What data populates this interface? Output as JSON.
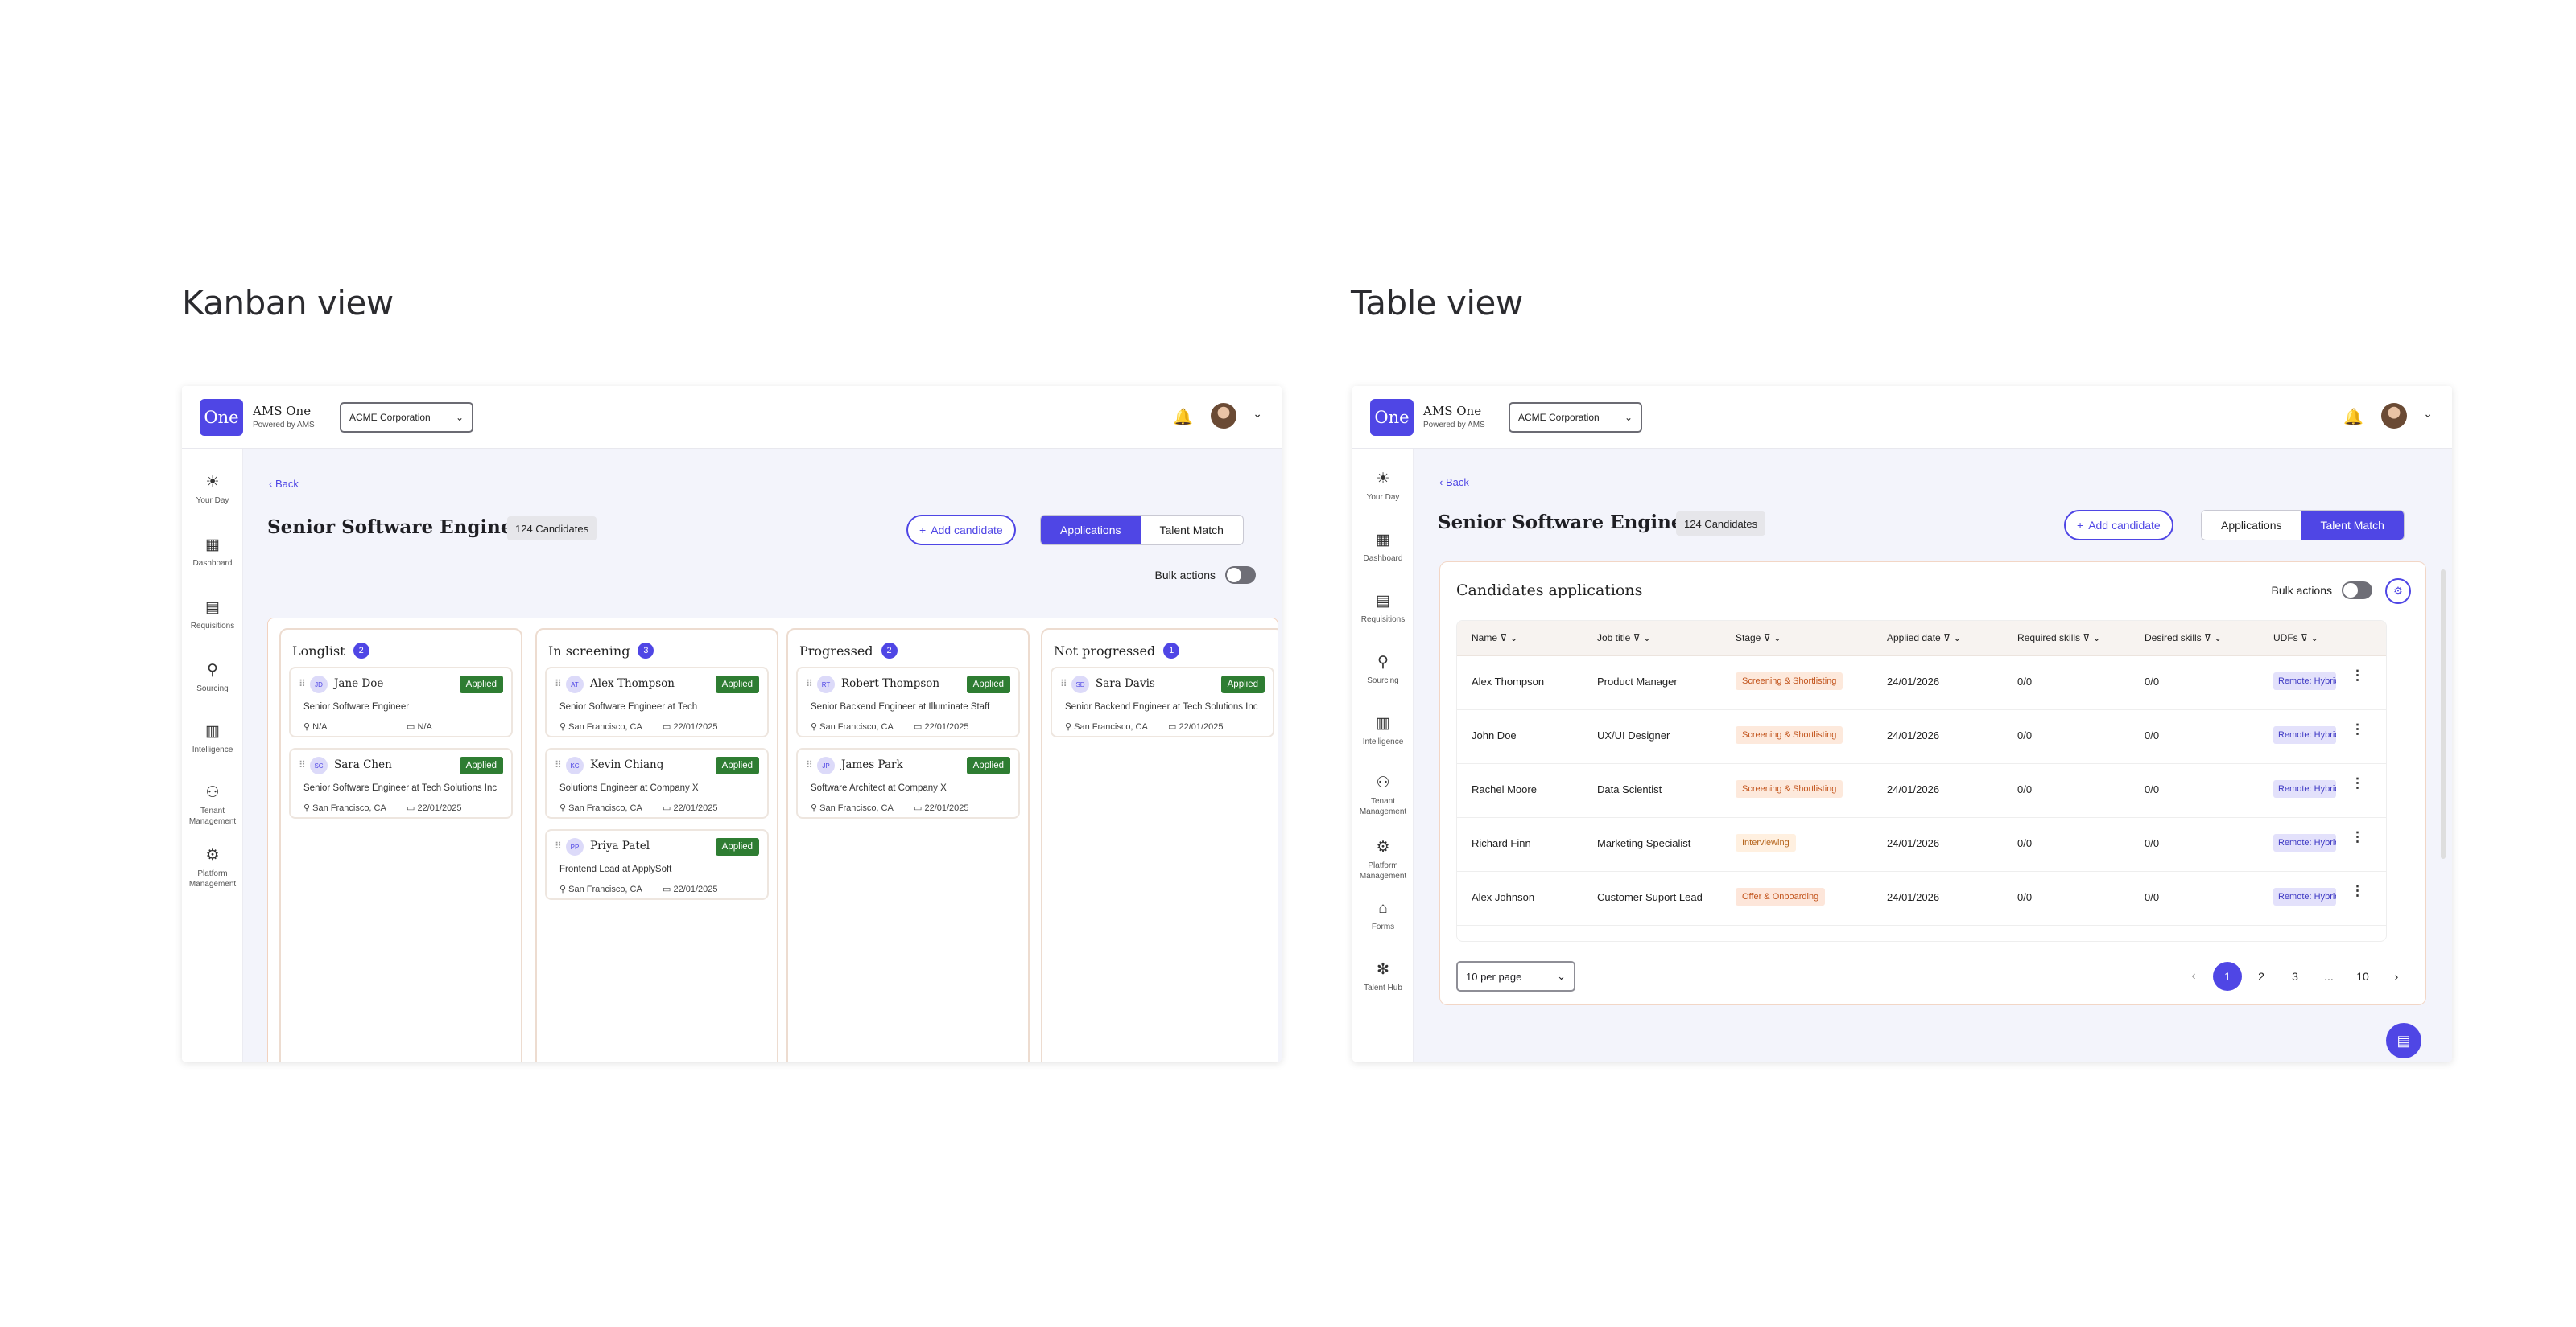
{
  "sections": {
    "kanban_title": "Kanban view",
    "table_title": "Table view"
  },
  "app": {
    "logo": "One",
    "name": "AMS One",
    "powered": "Powered by AMS",
    "org": "ACME Corporation",
    "chevron": "⌄"
  },
  "nav_kanban": [
    {
      "icon": "☀",
      "label": "Your Day"
    },
    {
      "icon": "▦",
      "label": "Dashboard"
    },
    {
      "icon": "▤",
      "label": "Requisitions"
    },
    {
      "icon": "⚲",
      "label": "Sourcing"
    },
    {
      "icon": "▥",
      "label": "Intelligence"
    },
    {
      "icon": "⚇",
      "label": "Tenant Management"
    },
    {
      "icon": "⚙",
      "label": "Platform Management"
    }
  ],
  "nav_table": [
    {
      "icon": "☀",
      "label": "Your Day"
    },
    {
      "icon": "▦",
      "label": "Dashboard"
    },
    {
      "icon": "▤",
      "label": "Requisitions"
    },
    {
      "icon": "⚲",
      "label": "Sourcing"
    },
    {
      "icon": "▥",
      "label": "Intelligence"
    },
    {
      "icon": "⚇",
      "label": "Tenant Management"
    },
    {
      "icon": "⚙",
      "label": "Platform Management"
    },
    {
      "icon": "⌂",
      "label": "Forms"
    },
    {
      "icon": "✻",
      "label": "Talent Hub"
    }
  ],
  "page": {
    "back": "‹ Back",
    "title": "Senior Software Engineer",
    "count": "124 Candidates",
    "add": "Add candidate",
    "tab_applications": "Applications",
    "tab_talent": "Talent Match",
    "bulk": "Bulk actions"
  },
  "kanban": {
    "columns": [
      {
        "title": "Longlist",
        "count": "2",
        "cards": [
          {
            "initials": "JD",
            "name": "Jane Doe",
            "status": "Applied",
            "role": "Senior Software Engineer",
            "location": "N/A",
            "date": "N/A"
          },
          {
            "initials": "SC",
            "name": "Sara Chen",
            "status": "Applied",
            "role": "Senior Software Engineer at Tech Solutions Inc",
            "location": "San Francisco, CA",
            "date": "22/01/2025"
          }
        ]
      },
      {
        "title": "In screening",
        "count": "3",
        "cards": [
          {
            "initials": "AT",
            "name": "Alex Thompson",
            "status": "Applied",
            "role": "Senior Software Engineer at Tech",
            "location": "San Francisco, CA",
            "date": "22/01/2025"
          },
          {
            "initials": "KC",
            "name": "Kevin Chiang",
            "status": "Applied",
            "role": "Solutions Engineer at Company X",
            "location": "San Francisco, CA",
            "date": "22/01/2025"
          },
          {
            "initials": "PP",
            "name": "Priya Patel",
            "status": "Applied",
            "role": "Frontend Lead at ApplySoft",
            "location": "San Francisco, CA",
            "date": "22/01/2025"
          }
        ]
      },
      {
        "title": "Progressed",
        "count": "2",
        "cards": [
          {
            "initials": "RT",
            "name": "Robert Thompson",
            "status": "Applied",
            "role": "Senior Backend Engineer at Illuminate Staff",
            "location": "San Francisco, CA",
            "date": "22/01/2025"
          },
          {
            "initials": "JP",
            "name": "James Park",
            "status": "Applied",
            "role": "Software Architect at Company X",
            "location": "San Francisco, CA",
            "date": "22/01/2025"
          }
        ]
      },
      {
        "title": "Not progressed",
        "count": "1",
        "cards": [
          {
            "initials": "SD",
            "name": "Sara Davis",
            "status": "Applied",
            "role": "Senior Backend Engineer at Tech Solutions Inc",
            "location": "San Francisco, CA",
            "date": "22/01/2025"
          }
        ]
      }
    ]
  },
  "table": {
    "title": "Candidates applications",
    "headers": [
      "Name",
      "Job title",
      "Stage",
      "Applied date",
      "Required skills",
      "Desired skills",
      "UDFs"
    ],
    "rows": [
      {
        "name": "Alex Thompson",
        "job": "Product Manager",
        "stage": "Screening & Shortlisting",
        "stage_kind": "screening",
        "date": "24/01/2026",
        "req": "0/0",
        "des": "0/0",
        "udf": "Remote: Hybrid"
      },
      {
        "name": "John Doe",
        "job": "UX/UI Designer",
        "stage": "Screening & Shortlisting",
        "stage_kind": "screening",
        "date": "24/01/2026",
        "req": "0/0",
        "des": "0/0",
        "udf": "Remote: Hybrid"
      },
      {
        "name": "Rachel Moore",
        "job": "Data Scientist",
        "stage": "Screening & Shortlisting",
        "stage_kind": "screening",
        "date": "24/01/2026",
        "req": "0/0",
        "des": "0/0",
        "udf": "Remote: Hybrid"
      },
      {
        "name": "Richard Finn",
        "job": "Marketing Specialist",
        "stage": "Interviewing",
        "stage_kind": "interviewing",
        "date": "24/01/2026",
        "req": "0/0",
        "des": "0/0",
        "udf": "Remote: Hybrid"
      },
      {
        "name": "Alex Johnson",
        "job": "Customer Suport Lead",
        "stage": "Offer & Onboarding",
        "stage_kind": "offer",
        "date": "24/01/2026",
        "req": "0/0",
        "des": "0/0",
        "udf": "Remote: Hybrid"
      }
    ],
    "per_page": "10 per page",
    "pages": [
      "1",
      "2",
      "3",
      "...",
      "10"
    ],
    "current_page": "1"
  },
  "colors": {
    "accent": "#4f46e5",
    "applied": "#2e7d32",
    "screening_bg": "#fde9dc",
    "screening_fg": "#c2541c",
    "interview_bg": "#fff0e0",
    "interview_fg": "#b5651d"
  }
}
